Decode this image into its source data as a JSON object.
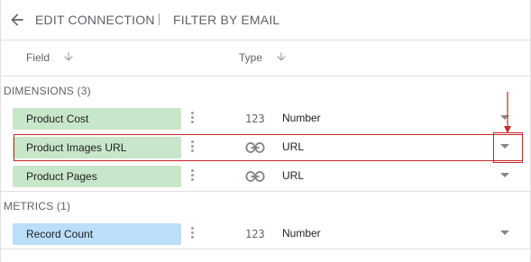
{
  "header": {
    "back_icon": "arrow-left-icon",
    "title": "EDIT CONNECTION",
    "subtitle": "FILTER BY EMAIL"
  },
  "columns": {
    "field_label": "Field",
    "type_label": "Type"
  },
  "dimensions": {
    "heading": "DIMENSIONS (3)",
    "rows": [
      {
        "name": "Product Cost",
        "type_icon": "123",
        "type": "Number"
      },
      {
        "name": "Product Images URL",
        "type_icon": "link-icon",
        "type": "URL"
      },
      {
        "name": "Product Pages",
        "type_icon": "link-icon",
        "type": "URL"
      }
    ]
  },
  "metrics": {
    "heading": "METRICS (1)",
    "rows": [
      {
        "name": "Record Count",
        "type_icon": "123",
        "type": "Number"
      }
    ]
  },
  "colors": {
    "dimension_chip": "#c8e6c9",
    "metric_chip": "#bbdefb",
    "annotation": "#c62828"
  }
}
